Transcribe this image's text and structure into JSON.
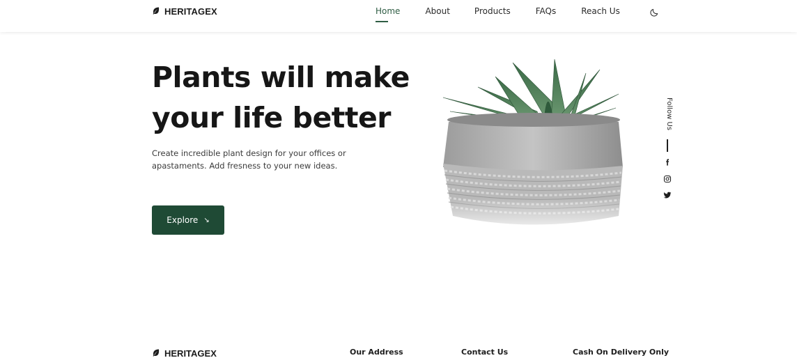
{
  "brand": {
    "name": "HERITAGEX",
    "icon": "leaf-icon"
  },
  "nav": {
    "items": [
      {
        "label": "Home",
        "active": true
      },
      {
        "label": "About",
        "active": false
      },
      {
        "label": "Products",
        "active": false
      },
      {
        "label": "FAQs",
        "active": false
      },
      {
        "label": "Reach Us",
        "active": false
      }
    ],
    "theme_icon": "moon-icon"
  },
  "hero": {
    "title_line1": "Plants will make",
    "title_line2": "your life better",
    "description": "Create incredible plant design for your offices or apastaments. Add fresness to your new ideas.",
    "button_label": "Explore",
    "button_icon": "arrow-down-right-icon"
  },
  "follow": {
    "label": "Follow Us",
    "icons": [
      "facebook-icon",
      "instagram-icon",
      "twitter-icon"
    ]
  },
  "footer": {
    "brand": "HERITAGEX",
    "columns": [
      "Our Address",
      "Contact Us",
      "Cash On Delivery Only"
    ]
  },
  "colors": {
    "accent": "#1f4a35",
    "nav_active": "#2f5d44",
    "text": "#161616"
  }
}
